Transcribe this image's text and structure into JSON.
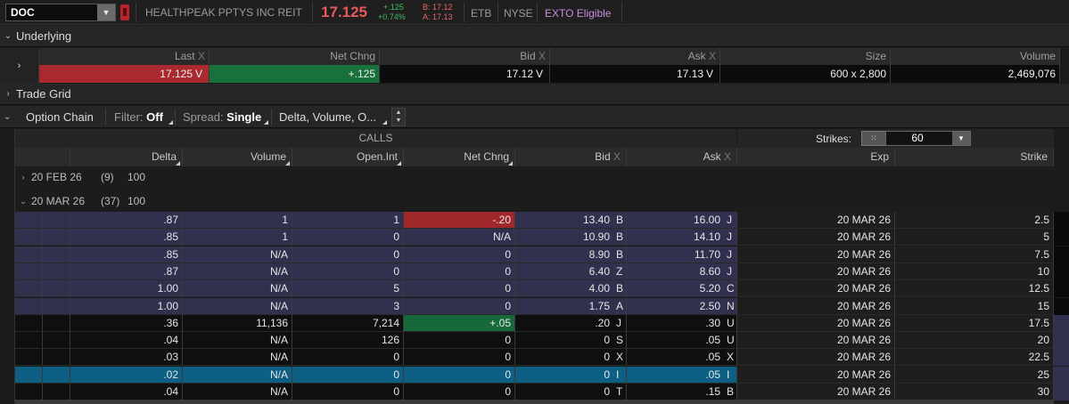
{
  "quote": {
    "symbol": "DOC",
    "company": "HEALTHPEAK PPTYS INC REIT",
    "last": "17.125",
    "net_change": "+.125",
    "pct_change": "+0.74%",
    "bid": "B: 17.12",
    "ask": "A: 17.13",
    "tags": [
      "ETB",
      "NYSE",
      "EXTO Eligible"
    ]
  },
  "underlying": {
    "title": "Underlying",
    "columns": [
      {
        "label": "Last",
        "x": "X"
      },
      {
        "label": "Net Chng",
        "x": ""
      },
      {
        "label": "Bid",
        "x": "X"
      },
      {
        "label": "Ask",
        "x": "X"
      },
      {
        "label": "Size",
        "x": ""
      },
      {
        "label": "Volume",
        "x": ""
      }
    ],
    "values": {
      "last": "17.125",
      "last_ex": "V",
      "net_chng": "+.125",
      "bid": "17.12",
      "bid_ex": "V",
      "ask": "17.13",
      "ask_ex": "V",
      "size": "600 x 2,800",
      "volume": "2,469,076"
    }
  },
  "trade_grid": {
    "title": "Trade Grid"
  },
  "option_chain": {
    "title": "Option Chain",
    "filter_label": "Filter:",
    "filter_value": "Off",
    "spread_label": "Spread:",
    "spread_value": "Single",
    "layout_value": "Delta, Volume, O...",
    "calls_label": "CALLS",
    "strikes_label": "Strikes:",
    "strikes_value": "60",
    "headers": {
      "delta": "Delta",
      "volume": "Volume",
      "open_int": "Open.Int",
      "net_chng": "Net Chng",
      "bid": "Bid",
      "ask": "Ask",
      "x": "X",
      "exp": "Exp",
      "strike": "Strike"
    },
    "expirations": [
      {
        "date": "20 FEB 26",
        "count": "(9)",
        "mult": "100"
      },
      {
        "date": "20 MAR 26",
        "count": "(37)",
        "mult": "100"
      }
    ],
    "rows": [
      {
        "delta": ".87",
        "volume": "1",
        "open_int": "1",
        "net_chng": "-.20",
        "bid": "13.40",
        "bid_ex": "B",
        "ask": "16.00",
        "ask_ex": "J",
        "exp": "20 MAR 26",
        "strike": "2.5",
        "state": "itm",
        "chg": "red"
      },
      {
        "delta": ".85",
        "volume": "1",
        "open_int": "0",
        "net_chng": "N/A",
        "bid": "10.90",
        "bid_ex": "B",
        "ask": "14.10",
        "ask_ex": "J",
        "exp": "20 MAR 26",
        "strike": "5",
        "state": "itm",
        "chg": ""
      },
      {
        "delta": ".85",
        "volume": "N/A",
        "open_int": "0",
        "net_chng": "0",
        "bid": "8.90",
        "bid_ex": "B",
        "ask": "11.70",
        "ask_ex": "J",
        "exp": "20 MAR 26",
        "strike": "7.5",
        "state": "itm",
        "chg": ""
      },
      {
        "delta": ".87",
        "volume": "N/A",
        "open_int": "0",
        "net_chng": "0",
        "bid": "6.40",
        "bid_ex": "Z",
        "ask": "8.60",
        "ask_ex": "J",
        "exp": "20 MAR 26",
        "strike": "10",
        "state": "itm",
        "chg": ""
      },
      {
        "delta": "1.00",
        "volume": "N/A",
        "open_int": "5",
        "net_chng": "0",
        "bid": "4.00",
        "bid_ex": "B",
        "ask": "5.20",
        "ask_ex": "C",
        "exp": "20 MAR 26",
        "strike": "12.5",
        "state": "itm",
        "chg": ""
      },
      {
        "delta": "1.00",
        "volume": "N/A",
        "open_int": "3",
        "net_chng": "0",
        "bid": "1.75",
        "bid_ex": "A",
        "ask": "2.50",
        "ask_ex": "N",
        "exp": "20 MAR 26",
        "strike": "15",
        "state": "itm",
        "chg": ""
      },
      {
        "delta": ".36",
        "volume": "11,136",
        "open_int": "7,214",
        "net_chng": "+.05",
        "bid": ".20",
        "bid_ex": "J",
        "ask": ".30",
        "ask_ex": "U",
        "exp": "20 MAR 26",
        "strike": "17.5",
        "state": "otm",
        "chg": "green"
      },
      {
        "delta": ".04",
        "volume": "N/A",
        "open_int": "126",
        "net_chng": "0",
        "bid": "0",
        "bid_ex": "S",
        "ask": ".05",
        "ask_ex": "U",
        "exp": "20 MAR 26",
        "strike": "20",
        "state": "otm",
        "chg": ""
      },
      {
        "delta": ".03",
        "volume": "N/A",
        "open_int": "0",
        "net_chng": "0",
        "bid": "0",
        "bid_ex": "X",
        "ask": ".05",
        "ask_ex": "X",
        "exp": "20 MAR 26",
        "strike": "22.5",
        "state": "otm",
        "chg": ""
      },
      {
        "delta": ".02",
        "volume": "N/A",
        "open_int": "0",
        "net_chng": "0",
        "bid": "0",
        "bid_ex": "I",
        "ask": ".05",
        "ask_ex": "I",
        "exp": "20 MAR 26",
        "strike": "25",
        "state": "sel",
        "chg": ""
      },
      {
        "delta": ".04",
        "volume": "N/A",
        "open_int": "0",
        "net_chng": "0",
        "bid": "0",
        "bid_ex": "T",
        "ask": ".15",
        "ask_ex": "B",
        "exp": "20 MAR 26",
        "strike": "30",
        "state": "otm",
        "chg": ""
      }
    ]
  },
  "colors": {
    "down": "#a0282c",
    "up": "#17693a",
    "itm_bg": "#31304f",
    "selected_bg": "#0d5f83",
    "last_price": "#e8595b",
    "exto": "#c98be0"
  }
}
